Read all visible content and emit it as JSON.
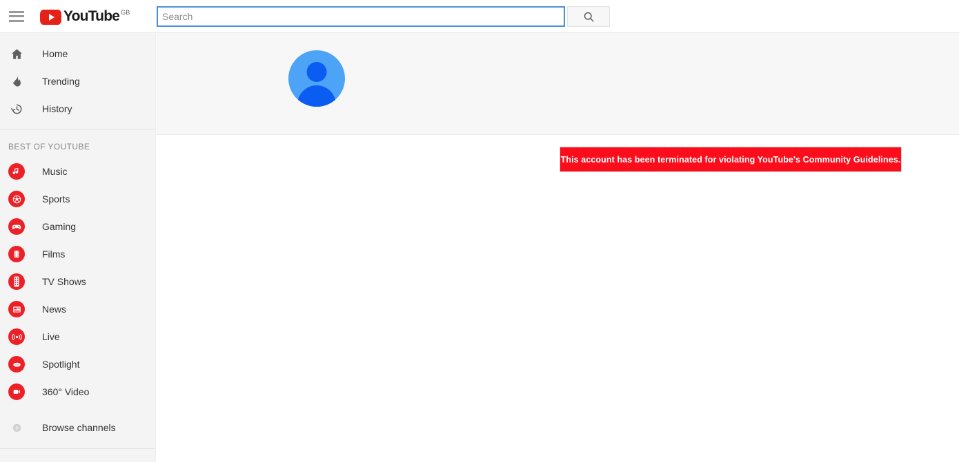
{
  "topbar": {
    "menu_icon": "hamburger-menu-icon",
    "logo_word": "YouTube",
    "logo_country": "GB",
    "search": {
      "placeholder": "Search",
      "value": "",
      "button_icon": "search-icon"
    }
  },
  "sidebar": {
    "primary": [
      {
        "label": "Home",
        "icon": "home-icon"
      },
      {
        "label": "Trending",
        "icon": "flame-icon"
      },
      {
        "label": "History",
        "icon": "history-clock-icon"
      }
    ],
    "section_title": "BEST OF YOUTUBE",
    "channels": [
      {
        "label": "Music",
        "icon": "music-note-icon"
      },
      {
        "label": "Sports",
        "icon": "sports-ball-icon"
      },
      {
        "label": "Gaming",
        "icon": "gamepad-icon"
      },
      {
        "label": "Films",
        "icon": "film-strip-icon"
      },
      {
        "label": "TV Shows",
        "icon": "tv-shows-icon"
      },
      {
        "label": "News",
        "icon": "newspaper-icon"
      },
      {
        "label": "Live",
        "icon": "live-broadcast-icon"
      },
      {
        "label": "Spotlight",
        "icon": "spotlight-icon"
      },
      {
        "label": "360° Video",
        "icon": "video-360-icon"
      }
    ],
    "browse": {
      "label": "Browse channels",
      "icon": "plus-circle-icon"
    }
  },
  "main": {
    "avatar": "default-user-avatar",
    "alert": {
      "message": "This account has been terminated for violating YouTube's Community Guidelines.",
      "background": "#fc0d1b",
      "text_color": "#ffffff"
    }
  },
  "colors": {
    "brand_red": "#e62117",
    "icon_red": "#ec2027",
    "sidebar_bg": "#f4f4f4",
    "banner_bg": "#f7f7f7",
    "avatar_blue": "#4da3f5",
    "avatar_blue_dark": "#0b5cf0",
    "focus_blue": "#4d90d9"
  }
}
